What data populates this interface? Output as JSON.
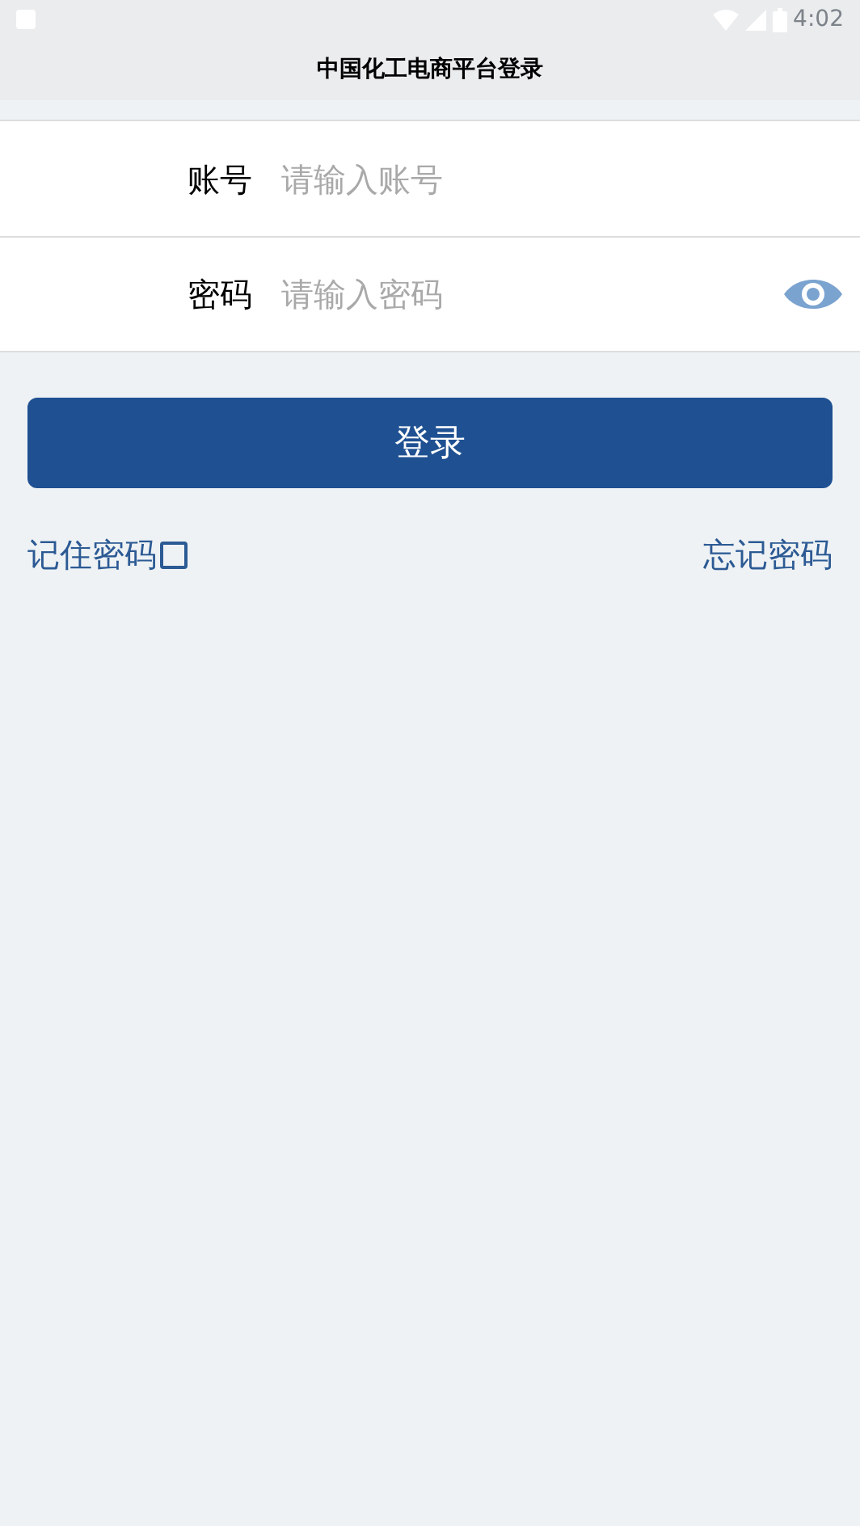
{
  "status_bar": {
    "time": "4:02"
  },
  "header": {
    "title": "中国化工电商平台登录"
  },
  "fields": [
    {
      "label": "账号",
      "placeholder": "请输入账号",
      "kind": "text"
    },
    {
      "label": "密码",
      "placeholder": "请输入密码",
      "kind": "password"
    }
  ],
  "login_button": "登录",
  "remember": {
    "label": "记住密码",
    "checked": false
  },
  "forgot_link": "忘记密码"
}
